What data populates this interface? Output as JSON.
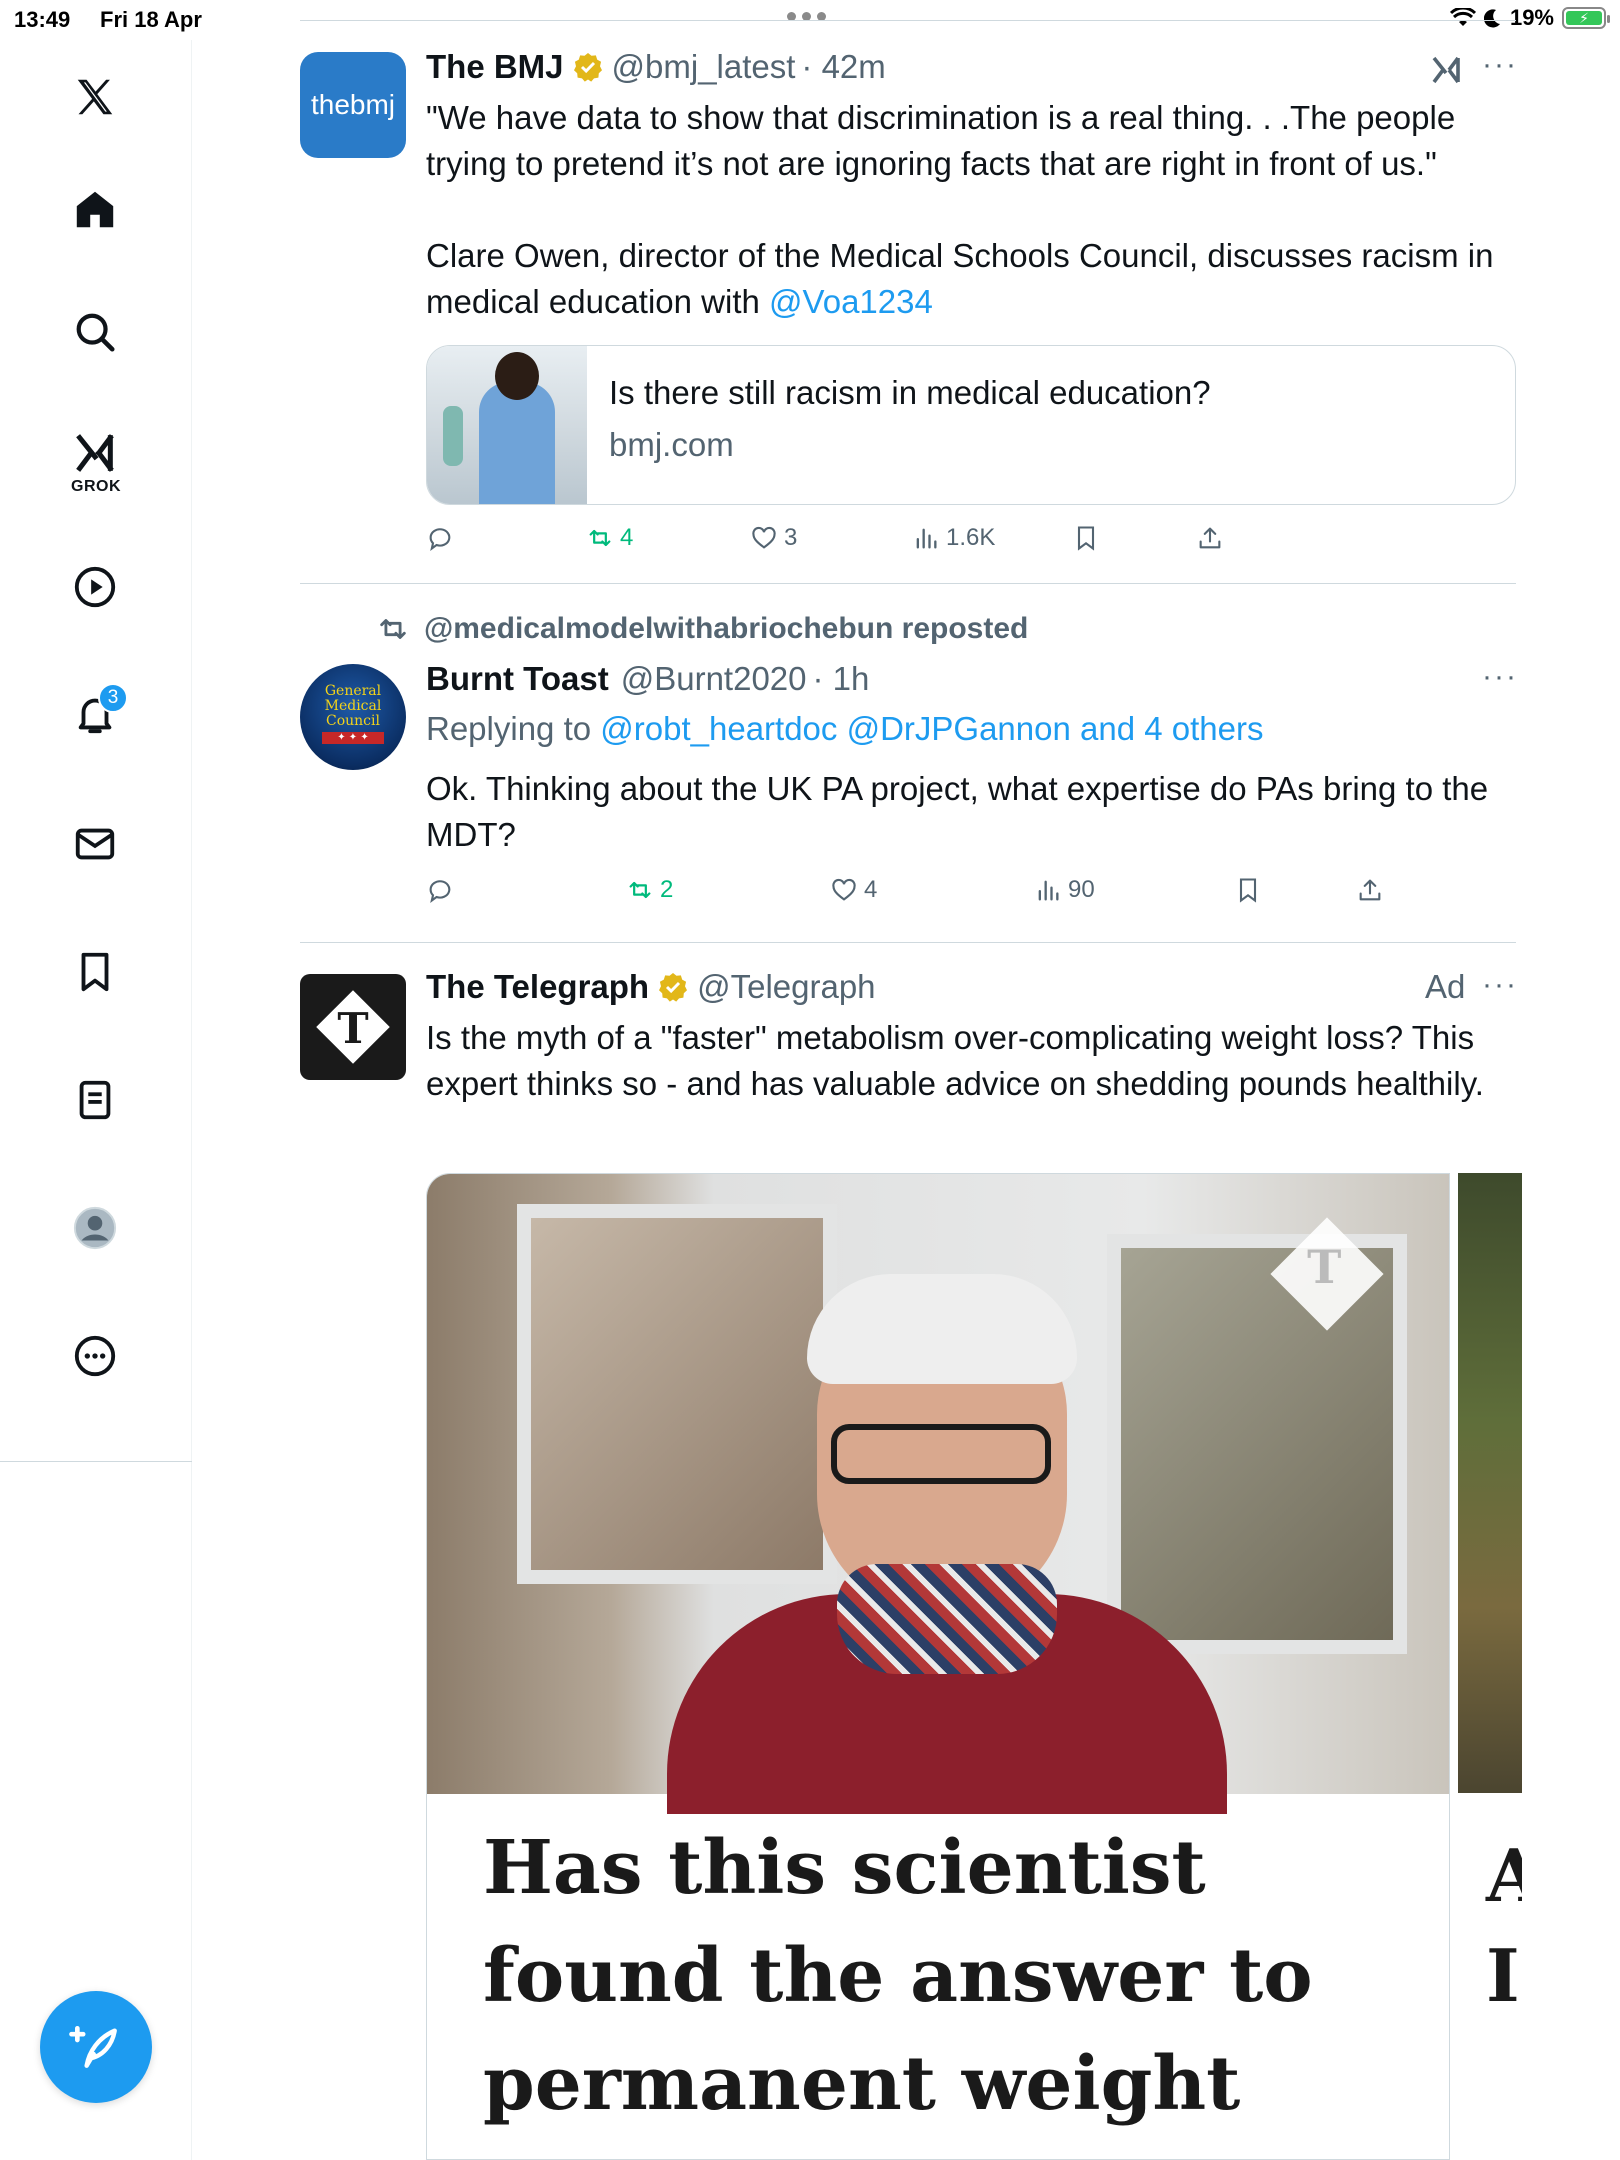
{
  "status_bar": {
    "time": "13:49",
    "date": "Fri 18 Apr",
    "battery": "19%"
  },
  "sidebar": {
    "items": [
      {
        "icon": "x-logo-icon"
      },
      {
        "icon": "home-icon"
      },
      {
        "icon": "search-icon"
      },
      {
        "icon": "grok-icon",
        "label": "GROK"
      },
      {
        "icon": "video-play-icon"
      },
      {
        "icon": "notifications-bell-icon",
        "badge": "3"
      },
      {
        "icon": "messages-envelope-icon"
      },
      {
        "icon": "bookmark-icon"
      },
      {
        "icon": "lists-icon"
      },
      {
        "icon": "profile-avatar-icon"
      },
      {
        "icon": "more-circle-icon"
      }
    ],
    "compose_icon": "compose-feather-icon"
  },
  "tweets": [
    {
      "name": "The BMJ",
      "handle": "@bmj_latest",
      "time": "· 42m",
      "avatar_text": "thebmj",
      "text_1": "\"We have data to show that discrimination is a real thing. . .The people trying to pretend it’s not are ignoring facts that are right in front of us.\"",
      "text_2": "Clare Owen, director of the Medical Schools Council, discusses racism in medical education with ",
      "mention": "@Voa1234",
      "card": {
        "title": "Is there still racism in medical education?",
        "domain": "bmj.com"
      },
      "stats": {
        "reposts": "4",
        "likes": "3",
        "views": "1.6K"
      }
    },
    {
      "repost_by": "@medicalmodelwithabriochebun reposted",
      "name": "Burnt Toast",
      "handle": "@Burnt2020",
      "time": "· 1h",
      "reply_prefix": "Replying to ",
      "reply_to": "@robt_heartdoc @DrJPGannon and 4 others",
      "text": "Ok. Thinking about the UK PA project, what expertise do PAs bring to the MDT?",
      "stats": {
        "reposts": "2",
        "likes": "4",
        "views": "90"
      }
    },
    {
      "name": "The Telegraph",
      "handle": "@Telegraph",
      "ad_label": "Ad",
      "text": "Is the myth of a \"faster\" metabolism over-complicating weight loss? This expert thinks so - and has valuable advice on shedding pounds healthily.",
      "media_headline": "Has this scientist found the answer to permanent weight loss?",
      "media2_glyphs": [
        "A",
        "I"
      ]
    }
  ],
  "colors": {
    "accent": "#1d9bf0",
    "repost_green": "#00ba7c",
    "secondary_text": "#536471",
    "verified_gold": "#e2b719"
  }
}
